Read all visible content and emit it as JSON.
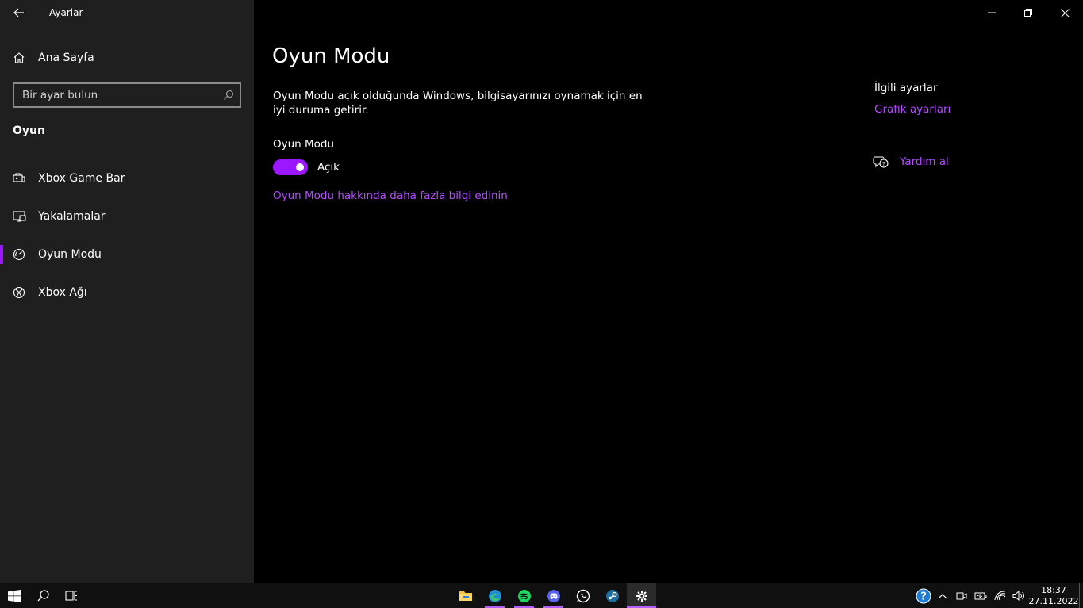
{
  "window": {
    "title": "Ayarlar"
  },
  "sidebar": {
    "home_label": "Ana Sayfa",
    "search_placeholder": "Bir ayar bulun",
    "section_title": "Oyun",
    "items": [
      {
        "label": "Xbox Game Bar",
        "icon": "game-bar-icon"
      },
      {
        "label": "Yakalamalar",
        "icon": "captures-icon"
      },
      {
        "label": "Oyun Modu",
        "icon": "game-mode-icon",
        "selected": true
      },
      {
        "label": "Xbox Ağı",
        "icon": "xbox-icon"
      }
    ]
  },
  "main": {
    "page_title": "Oyun Modu",
    "description": "Oyun Modu açık olduğunda Windows, bilgisayarınızı oynamak için en iyi duruma getirir.",
    "setting_label": "Oyun Modu",
    "toggle_on": true,
    "toggle_state": "Açık",
    "learn_more": "Oyun Modu hakkında daha fazla bilgi edinin"
  },
  "related": {
    "title": "İlgili ayarlar",
    "link": "Grafik ayarları",
    "help": "Yardım al"
  },
  "taskbar": {
    "apps": [
      "file-explorer-icon",
      "edge-icon",
      "spotify-icon",
      "discord-icon",
      "whatsapp-icon",
      "steam-icon",
      "settings-icon"
    ],
    "time": "18:37",
    "date": "27.11.2022"
  },
  "colors": {
    "accent": "#9b17ff",
    "link": "#b44bff",
    "sidebar_bg": "#1f1f1f",
    "main_bg": "#000000"
  }
}
